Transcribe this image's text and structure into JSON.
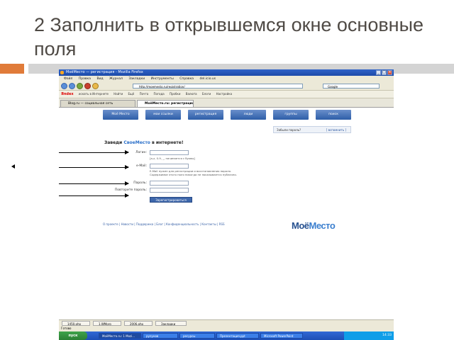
{
  "slide": {
    "title": "2 Заполнить в открывшемся окне основные поля"
  },
  "colors": {
    "accent_orange": "#e07b39",
    "title_text": "#4f4a45",
    "xp_blue": "#2f63c8",
    "site_blue": "#2e5ea8"
  },
  "browser": {
    "window_title": "МоёМесто — регистрация - Mozilla Firefox",
    "menu": [
      "Файл",
      "Правка",
      "Вид",
      "Журнал",
      "Закладки",
      "Инструменты",
      "Справка",
      "del.icio.us"
    ],
    "address": "http://moemesto.ru/registration/",
    "search_placeholder": "Google",
    "toolbar_items": [
      "Яndex",
      "искать в Интернете",
      "Найти",
      "Ещё",
      "Почта",
      "Погода",
      "Пробки",
      "Валюта",
      "Блоги",
      "Настройка"
    ],
    "tabs": [
      {
        "label": "Blog.ru — социальная сеть",
        "active": false
      },
      {
        "label": "МоёМесто.ru: регистрация",
        "active": true
      }
    ]
  },
  "site": {
    "nav": [
      "Моё Место",
      "мои ссылки",
      "регистрация",
      "люди",
      "группы",
      "поиск"
    ],
    "forgot_password": "Забыли пароль?",
    "forgot_link": "[ вспомнить ]",
    "heading_prefix": "Заведи",
    "heading_brand": "СвоеМесто",
    "heading_suffix": "в интернете!",
    "form": {
      "login_label": "Логин:",
      "login_hint": "[a-z, 0-9, _, начинается с буквы]",
      "email_label": "e-Mail:",
      "email_hint_1": "E-Mail нужен для регистрации и восстановления пароля.",
      "email_hint_2": "Содержимое этого поля никогда не показывается публично.",
      "password_label": "Пароль:",
      "password_repeat_label": "Повторите пароль:",
      "submit_label": "Зарегистрироваться"
    },
    "footer_links": "О проекте | Новости | Поддержка | Блог | Конфиденциальность | Контакты | RSS",
    "logo_main": "Моё",
    "logo_accent": "Место"
  },
  "lower_tabs": [
    "1450.php",
    "1.WMpro",
    "2006.php",
    "Закладки"
  ],
  "status_text": "Готово",
  "taskbar": {
    "start_label": "пуск",
    "tasks": [
      "МоёМесто.ru: 1 Mozi...",
      "рулунов",
      "ресурсы",
      "Презентация.ppt",
      "Microsoft PowerPoint"
    ],
    "clock": "14:33"
  }
}
